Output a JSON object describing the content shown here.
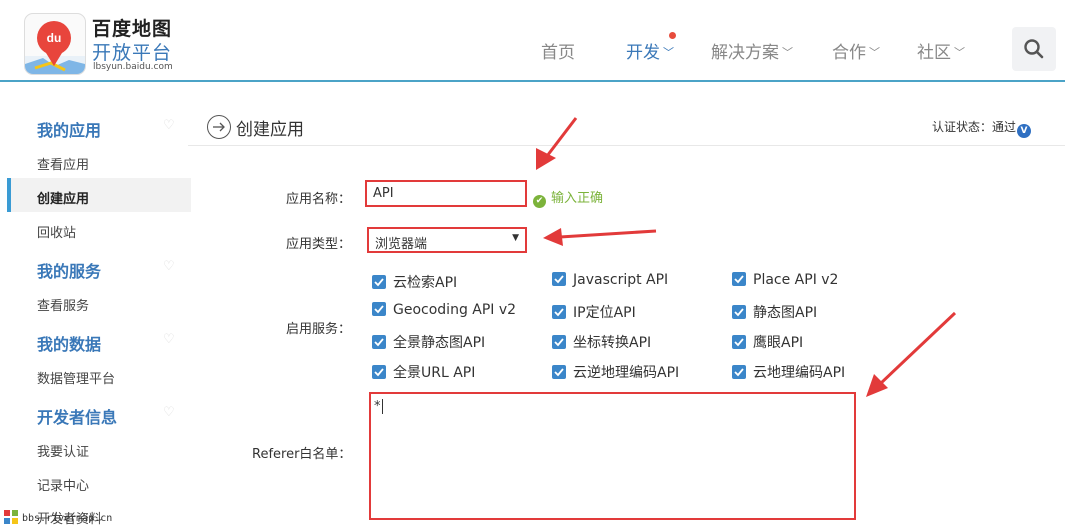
{
  "header": {
    "brand": {
      "line1": "百度地图",
      "line2": "开放平台",
      "domain": "lbsyun.baidu.com",
      "logo_text": "du"
    },
    "nav": [
      {
        "label": "首页",
        "has_dropdown": false
      },
      {
        "label": "开发",
        "has_dropdown": true,
        "active": true
      },
      {
        "label": "解决方案",
        "has_dropdown": true
      },
      {
        "label": "合作",
        "has_dropdown": true
      },
      {
        "label": "社区",
        "has_dropdown": true
      }
    ],
    "search_icon": "search-icon",
    "accent": "#3a78b8"
  },
  "sidebar": {
    "sections": [
      {
        "title": "我的应用",
        "items": [
          "查看应用",
          "创建应用",
          "回收站"
        ]
      },
      {
        "title": "我的服务",
        "items": [
          "查看服务"
        ]
      },
      {
        "title": "我的数据",
        "items": [
          "数据管理平台"
        ]
      },
      {
        "title": "开发者信息",
        "items": [
          "我要认证",
          "记录中心",
          "开发者资料"
        ]
      }
    ],
    "active_item": "创建应用"
  },
  "page": {
    "title": "创建应用",
    "cert_label": "认证状态：通过",
    "cert_badge": "V"
  },
  "form": {
    "name_label": "应用名称：",
    "name_value": "API",
    "name_status": "输入正确",
    "type_label": "应用类型：",
    "type_value": "浏览器端",
    "services_label": "启用服务：",
    "services": [
      [
        "云检索API",
        "Javascript API",
        "Place API v2"
      ],
      [
        "Geocoding API v2",
        "IP定位API",
        "静态图API"
      ],
      [
        "全景静态图API",
        "坐标转换API",
        "鹰眼API"
      ],
      [
        "全景URL API",
        "云逆地理编码API",
        "云地理编码API"
      ]
    ],
    "referer_label": "Referer白名单：",
    "referer_value": "*"
  },
  "watermark": "bbs.rivermap.cn",
  "colors": {
    "highlight_red": "#e23a3a",
    "checkbox_blue": "#3b86c9",
    "ok_green": "#7cb33b"
  }
}
